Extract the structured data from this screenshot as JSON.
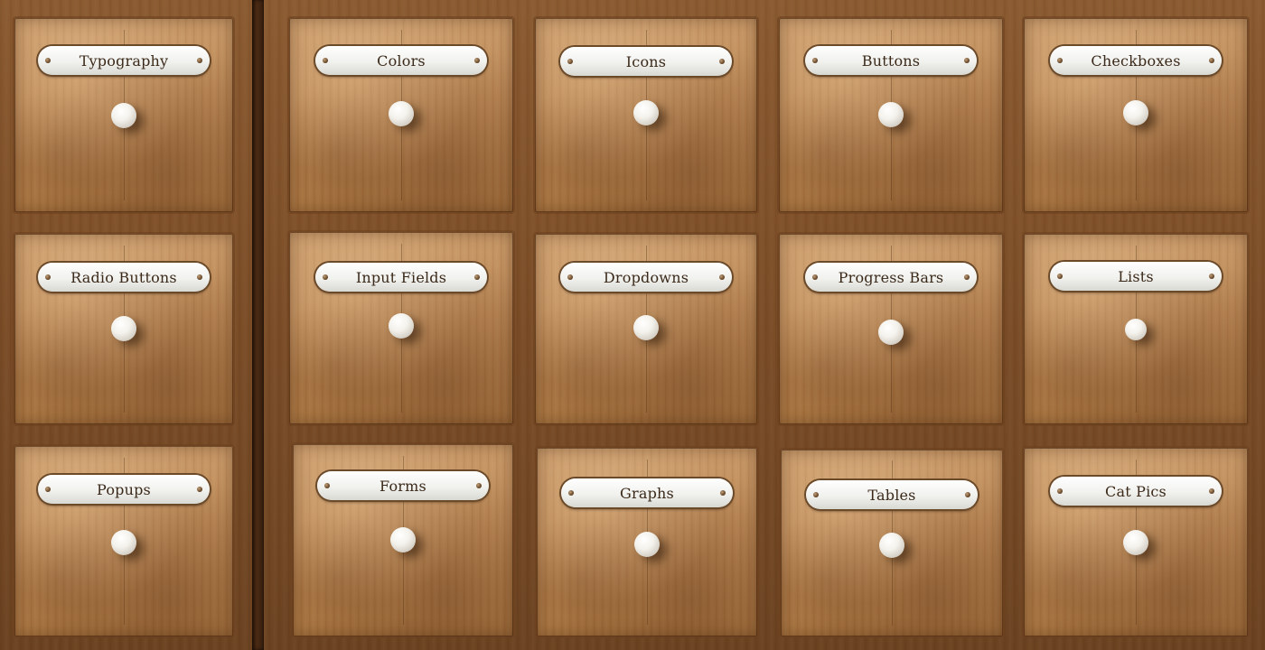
{
  "cabinet": {
    "drawers": [
      {
        "label": "Typography"
      },
      {
        "label": "Colors"
      },
      {
        "label": "Icons"
      },
      {
        "label": "Buttons"
      },
      {
        "label": "Checkboxes"
      },
      {
        "label": "Radio Buttons"
      },
      {
        "label": "Input Fields"
      },
      {
        "label": "Dropdowns"
      },
      {
        "label": "Progress Bars"
      },
      {
        "label": "Lists"
      },
      {
        "label": "Popups"
      },
      {
        "label": "Forms"
      },
      {
        "label": "Graphs"
      },
      {
        "label": "Tables"
      },
      {
        "label": "Cat Pics"
      }
    ]
  },
  "colors": {
    "wood": "#b98552",
    "plate": "#f1f1ee",
    "plate_text": "#3b2a1a",
    "knob": "#f4f2ec"
  }
}
